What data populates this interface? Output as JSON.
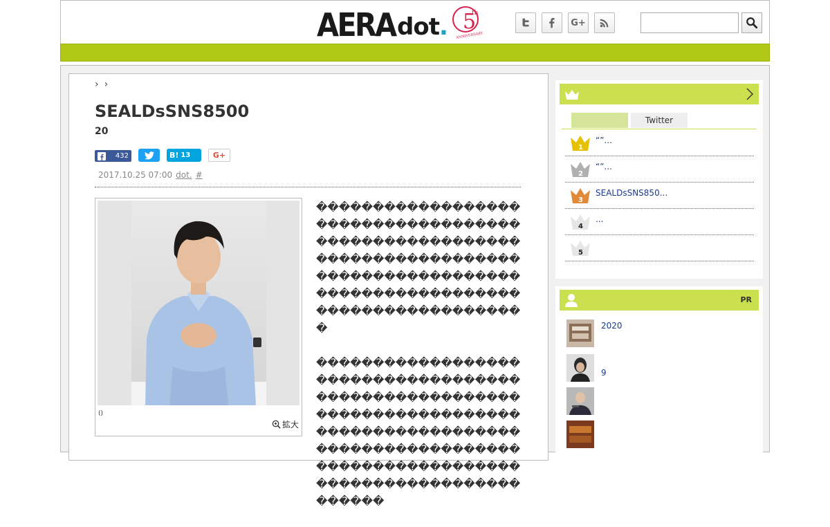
{
  "header": {
    "logo_aera": "AERA",
    "logo_dot": "dot",
    "anniversary_number": "5",
    "anniversary_suffix": "th",
    "anniversary_text": "ANNIVERSARY",
    "social": [
      {
        "name": "twitter-icon"
      },
      {
        "name": "facebook-icon"
      },
      {
        "name": "google-plus-icon",
        "label": "G+"
      },
      {
        "name": "rss-icon"
      }
    ],
    "search": {
      "placeholder": "",
      "value": ""
    },
    "accent_color": "#b0c816"
  },
  "article": {
    "breadcrumb": [
      "›",
      "›"
    ],
    "title": "SEALDsSNS8500",
    "subtitle": "20",
    "share": {
      "facebook_count": "432",
      "hatena_label": "B!",
      "hatena_count": "13",
      "googleplus_label": "G+"
    },
    "meta": {
      "datetime": "2017.10.25 07:00",
      "source": "dot.",
      "hash": "#"
    },
    "photo_caption": "()",
    "zoom_label": "拡大",
    "paragraphs": [
      "�������������������������������������������������������������������������������������������������������������������������������",
      "������������������������������������������������������������������������������������������������������������������������������������������������������"
    ]
  },
  "ranking": {
    "tabs": [
      "",
      "Twitter"
    ],
    "items": [
      {
        "rank": "1",
        "text": "“”...",
        "color": "#e5c100"
      },
      {
        "rank": "2",
        "text": "“”...",
        "color": "#b0b0b0"
      },
      {
        "rank": "3",
        "text": "SEALDsSNS850...",
        "color": "#e08a3a"
      },
      {
        "rank": "4",
        "text": "...",
        "color": "#e6e6e6"
      },
      {
        "rank": "5",
        "text": "",
        "color": "#e6e6e6"
      }
    ]
  },
  "pr": {
    "label": "PR",
    "items": [
      {
        "text": "2020"
      },
      {
        "text": "9"
      },
      {
        "text": ""
      },
      {
        "text": ""
      }
    ]
  }
}
